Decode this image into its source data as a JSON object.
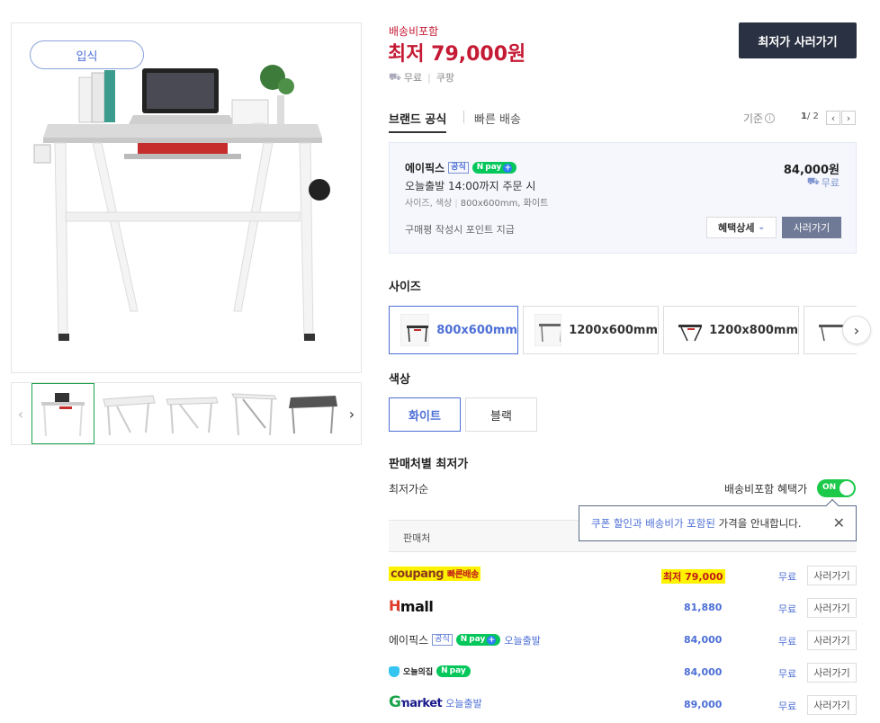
{
  "product": {
    "stock_badge": "입식",
    "thumbnails": [
      "thumb-1",
      "thumb-2",
      "thumb-3",
      "thumb-4",
      "thumb-5"
    ]
  },
  "price_box": {
    "shipping_included_label": "배송비포함",
    "lowest_price": "최저 79,000원",
    "shipping": "무료",
    "mall": "쿠팡",
    "buy_lowest_button": "최저가 사러가기"
  },
  "tabs": {
    "brand_official": "브랜드 공식",
    "fast_delivery": "빠른 배송",
    "criteria_label": "기준",
    "page_current": "1",
    "page_total": "/ 2"
  },
  "official_card": {
    "seller": "에이픽스",
    "official_tag": "공식",
    "npay": "pay",
    "delivery": "오늘출발 14:00까지 주문 시",
    "options_prefix": "사이즈, 색상",
    "options_value": "800x600mm, 화이트",
    "review_point": "구매평 작성시 포인트 지급",
    "price": "84,000원",
    "shipping": "무료",
    "benefit_button": "혜택상세",
    "buy_button": "사러가기"
  },
  "size_section": {
    "title": "사이즈",
    "options": [
      "800x600mm",
      "1200x600mm",
      "1200x800mm"
    ],
    "selected": "800x600mm"
  },
  "color_section": {
    "title": "색상",
    "options": [
      "화이트",
      "블랙"
    ],
    "selected": "화이트"
  },
  "seller_section": {
    "title": "판매처별 최저가",
    "sort_label": "최저가순",
    "toggle_label": "배송비포함 혜택가",
    "toggle_state": "ON",
    "table_header": "판매처",
    "tooltip_part1": "쿠폰 할인과 배송비가 포함된",
    "tooltip_part2": "가격을 안내합니다.",
    "rows": [
      {
        "mall": "coupang",
        "extra": "빠른배송",
        "price": "최저 79,000",
        "shipping": "무료",
        "buy": "사러가기"
      },
      {
        "mall": "Hmall",
        "extra": "",
        "price": "81,880",
        "shipping": "무료",
        "buy": "사러가기"
      },
      {
        "mall": "에이픽스",
        "tag": "공식",
        "npay": "pay",
        "extra": "오늘출발",
        "price": "84,000",
        "shipping": "무료",
        "buy": "사러가기"
      },
      {
        "mall": "오늘의집",
        "npay": "pay",
        "extra": "",
        "price": "84,000",
        "shipping": "무료",
        "buy": "사러가기"
      },
      {
        "mall": "Gmarket",
        "extra": "오늘출발",
        "price": "89,000",
        "shipping": "무료",
        "buy": "사러가기"
      }
    ]
  },
  "colors": {
    "accent": "#4d6fd6",
    "price_red": "#c51a34",
    "dark_button": "#2a3142",
    "toggle_green": "#1dc94b",
    "highlight": "#fff200"
  }
}
